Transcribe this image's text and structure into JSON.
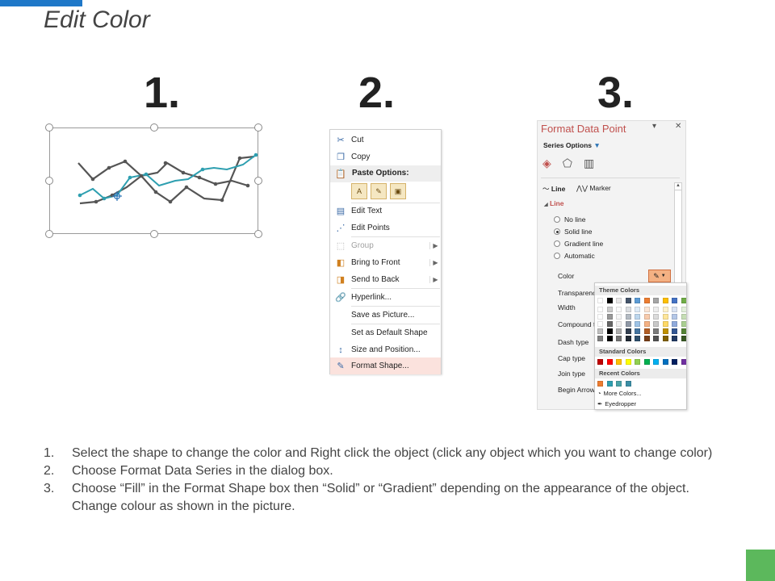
{
  "slide": {
    "title": "Edit Color",
    "accent_color": "#1f78c8",
    "corner_color": "#5cb85c"
  },
  "steps": {
    "one": "1.",
    "two": "2.",
    "three": "3."
  },
  "context_menu": {
    "items": [
      {
        "icon": "scissors-icon",
        "label": "Cut"
      },
      {
        "icon": "copy-icon",
        "label": "Copy"
      },
      {
        "icon": "paste-icon",
        "label": "Paste Options:"
      },
      {
        "icon": "edit-text-icon",
        "label": "Edit Text"
      },
      {
        "icon": "edit-points-icon",
        "label": "Edit Points"
      },
      {
        "icon": "group-icon",
        "label": "Group",
        "disabled": true,
        "submenu": true
      },
      {
        "icon": "bring-front-icon",
        "label": "Bring to Front",
        "submenu": true
      },
      {
        "icon": "send-back-icon",
        "label": "Send to Back",
        "submenu": true
      },
      {
        "icon": "hyperlink-icon",
        "label": "Hyperlink..."
      },
      {
        "label": "Save as Picture..."
      },
      {
        "label": "Set as Default Shape"
      },
      {
        "icon": "size-position-icon",
        "label": "Size and Position..."
      },
      {
        "icon": "format-shape-icon",
        "label": "Format Shape...",
        "highlighted": true
      }
    ]
  },
  "format_pane": {
    "title": "Format Data Point",
    "series_options": "Series Options",
    "tabs": [
      "Line",
      "Marker"
    ],
    "section": "Line",
    "radio_options": [
      {
        "label": "No line",
        "selected": false
      },
      {
        "label": "Solid line",
        "selected": true
      },
      {
        "label": "Gradient line",
        "selected": false
      },
      {
        "label": "Automatic",
        "selected": false
      }
    ],
    "properties": [
      "Color",
      "Transparenc",
      "Width",
      "Compound t",
      "Dash type",
      "Cap type",
      "Join type",
      "Begin Arrow"
    ],
    "title_color": "#c0504d"
  },
  "color_popup": {
    "theme_header": "Theme Colors",
    "standard_header": "Standard Colors",
    "recent_header": "Recent Colors",
    "more_colors": "More Colors...",
    "eyedropper": "Eyedropper",
    "theme_colors": [
      "#ffffff",
      "#000000",
      "#e7e6e6",
      "#44546a",
      "#5b9bd5",
      "#ed7d31",
      "#a5a5a5",
      "#ffc000",
      "#4472c4",
      "#70ad47"
    ],
    "standard_colors": [
      "#c00000",
      "#ff0000",
      "#ffc000",
      "#ffff00",
      "#92d050",
      "#00b050",
      "#00b0f0",
      "#0070c0",
      "#002060",
      "#7030a0"
    ],
    "recent_colors": [
      "#ed7d31",
      "#2e9fb0",
      "#4aa3a8",
      "#3b8ea5"
    ]
  },
  "instructions": [
    {
      "num": "1.",
      "text": "Select the shape to change the color and Right click the object (click any object which you want to change color)"
    },
    {
      "num": "2.",
      "text": "Choose Format Data Series in the dialog box."
    },
    {
      "num": "3.",
      "text": "Choose “Fill” in the Format Shape box then “Solid” or “Gradient” depending on the appearance of the object. Change colour as shown in the picture."
    }
  ]
}
